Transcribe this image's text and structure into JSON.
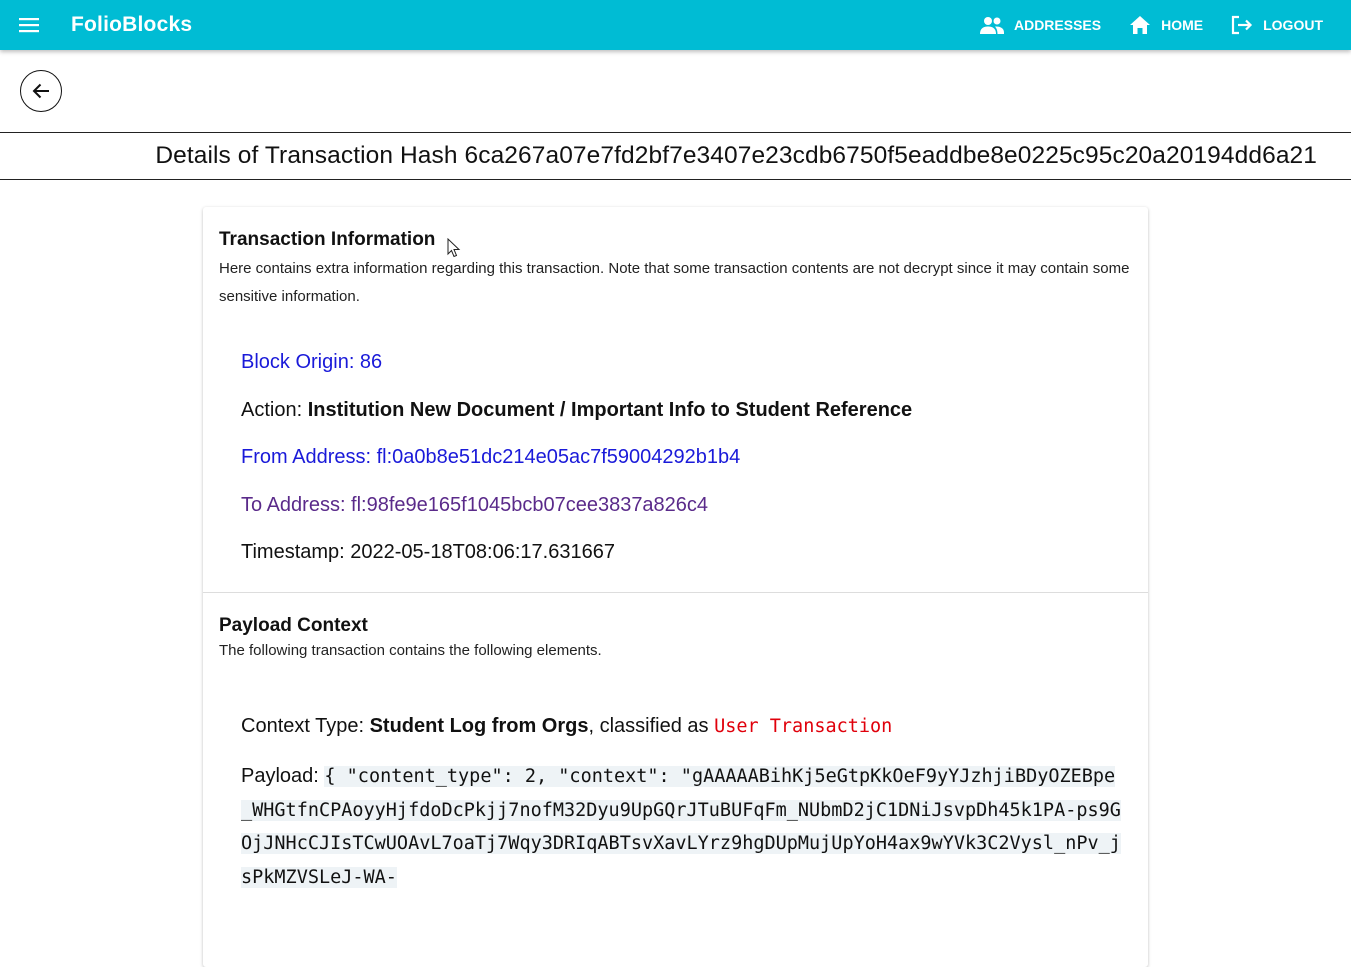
{
  "appbar": {
    "brand": "FolioBlocks",
    "nav": [
      {
        "label": "ADDRESSES",
        "icon": "people-icon"
      },
      {
        "label": "HOME",
        "icon": "home-icon"
      },
      {
        "label": "LOGOUT",
        "icon": "logout-icon"
      }
    ],
    "color": "#00bcd4"
  },
  "page": {
    "title": "Details of Transaction Hash 6ca267a07e7fd2bf7e3407e23cdb6750f5eaddbe8e0225c95c20a20194dd6a21"
  },
  "transaction_info": {
    "title": "Transaction Information",
    "subtitle": "Here contains extra information regarding this transaction. Note that some transaction contents are not decrypt since it may contain some sensitive information.",
    "block_origin": "Block Origin: 86",
    "action_label": "Action: ",
    "action_value": "Institution New Document / Important Info to Student Reference",
    "from_address": "From Address: fl:0a0b8e51dc214e05ac7f59004292b1b4",
    "to_address": "To Address: fl:98fe9e165f1045bcb07cee3837a826c4",
    "timestamp": "Timestamp: 2022-05-18T08:06:17.631667"
  },
  "payload_context": {
    "title": "Payload Context",
    "subtitle": "The following transaction contains the following elements.",
    "context_type_label": "Context Type: ",
    "context_type_value": "Student Log from Orgs",
    "classified_label": ", classified as ",
    "classified_value": "User Transaction",
    "payload_label": "Payload: ",
    "payload_value": "{ \"content_type\": 2, \"context\": \"gAAAAABihKj5eGtpKkOeF9yYJzhjiBDyOZEBpe_WHGtfnCPAoyyHjfdoDcPkjj7nofM32Dyu9UpGQrJTuBUFqFm_NUbmD2jC1DNiJsvpDh45k1PA-ps9GOjJNHcCJIsTCwUOAvL7oaTj7Wqy3DRIqABTsvXavLYrz9hgDUpMujUpYoH4ax9wYVk3C2Vysl_nPv_jsPkMZVSLeJ-WA-"
  }
}
